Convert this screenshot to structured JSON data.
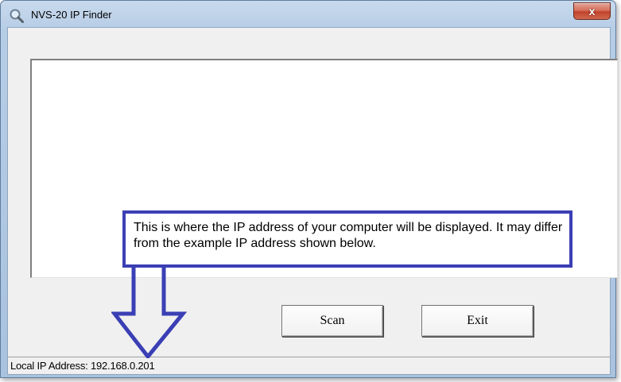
{
  "window": {
    "title": "NVS-20 IP Finder",
    "close_glyph": "x"
  },
  "buttons": {
    "scan": "Scan",
    "exit": "Exit"
  },
  "status_bar": {
    "text": "Local IP Address: 192.168.0.201"
  },
  "annotation": {
    "text": "This is where the IP address of your computer will be displayed. It may differ from the example IP address shown below.",
    "color": "#3b3fb5"
  },
  "icons": {
    "title": "magnifier-icon",
    "close": "close-icon",
    "annotation_arrow": "arrow-down-icon"
  }
}
